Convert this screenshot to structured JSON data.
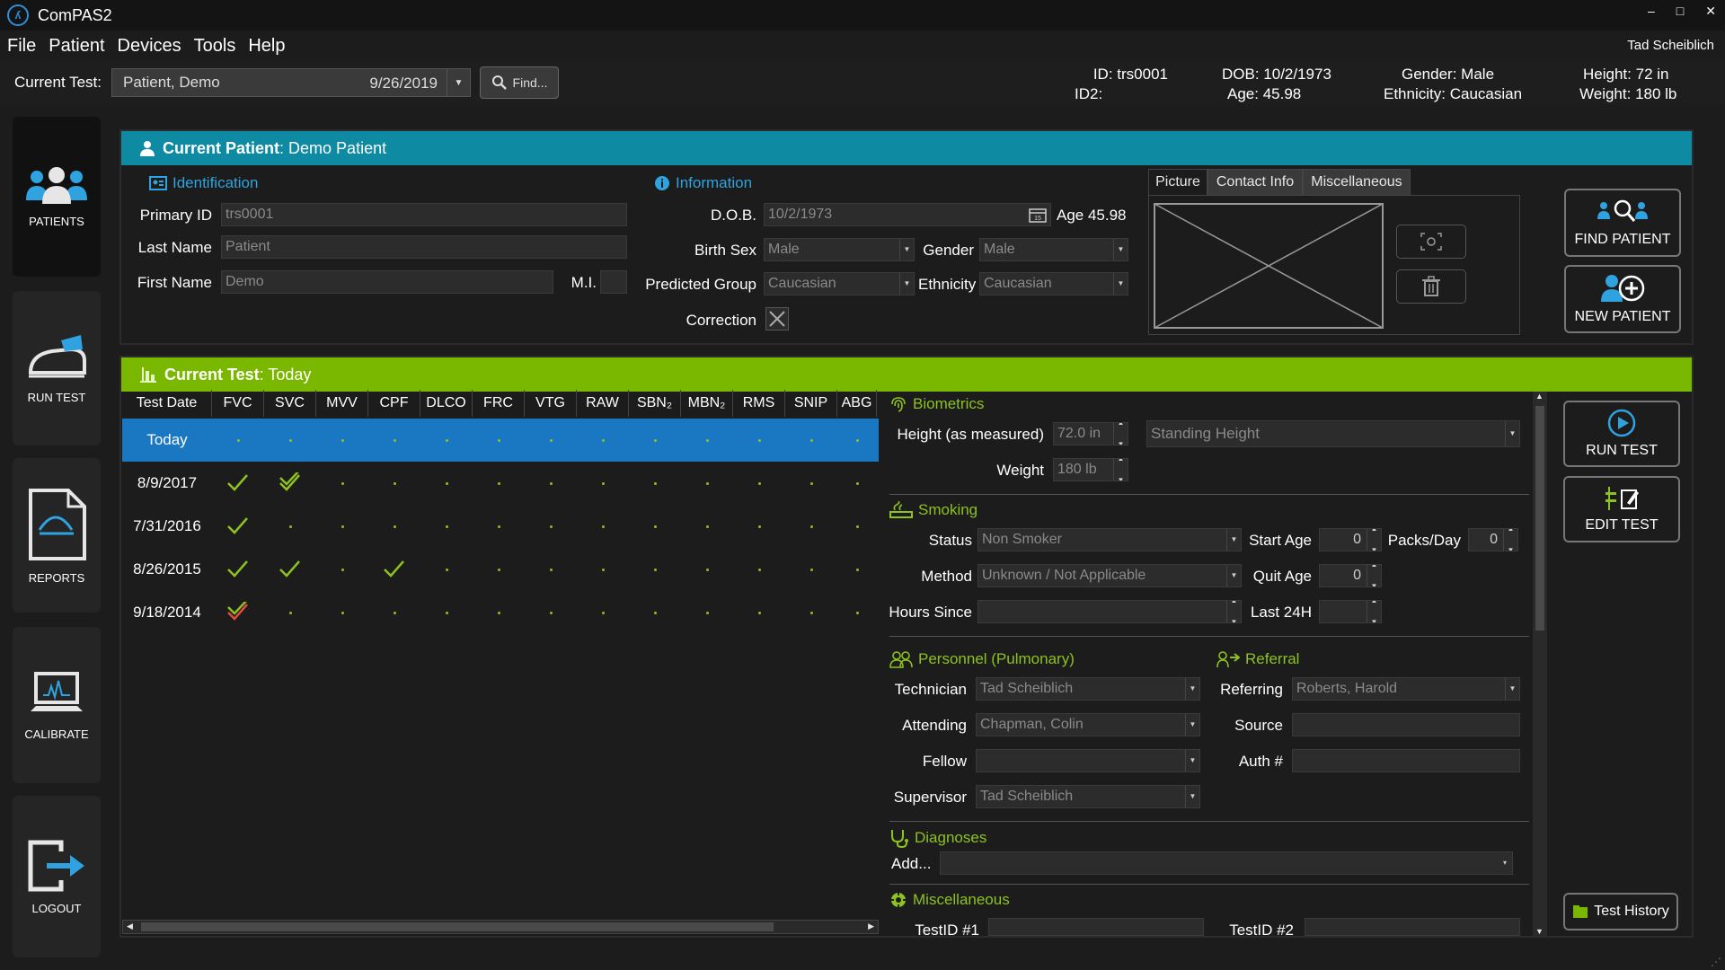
{
  "app": {
    "title": "ComPAS2",
    "logo": "compas-logo-icon",
    "window_controls": [
      "–",
      "□",
      "✕"
    ]
  },
  "menu": [
    "File",
    "Patient",
    "Devices",
    "Tools",
    "Help"
  ],
  "user": "Tad Scheiblich",
  "toolbar": {
    "current_test_label": "Current Test:",
    "current_test_patient": "Patient, Demo",
    "current_test_date": "9/26/2019",
    "find_label": "Find..."
  },
  "patient_summary": {
    "id_label": "ID:",
    "id": "trs0001",
    "id2_label": "ID2:",
    "dob_label": "DOB:",
    "dob": "10/2/1973",
    "age_label": "Age:",
    "age": "45.98",
    "gender_label": "Gender:",
    "gender": "Male",
    "ethnicity_label": "Ethnicity:",
    "ethnicity": "Caucasian",
    "height_label": "Height:",
    "height": "72 in",
    "weight_label": "Weight:",
    "weight": "180 lb"
  },
  "nav": [
    {
      "label": "PATIENTS",
      "icon": "patients-icon"
    },
    {
      "label": "RUN TEST",
      "icon": "run-test-icon"
    },
    {
      "label": "REPORTS",
      "icon": "reports-icon"
    },
    {
      "label": "CALIBRATE",
      "icon": "calibrate-icon"
    },
    {
      "label": "LOGOUT",
      "icon": "logout-icon"
    }
  ],
  "current_patient": {
    "header_bold": "Current Patient",
    "header_rest": " : Demo Patient",
    "identification": {
      "title": "Identification",
      "primary_id_label": "Primary ID",
      "primary_id": "trs0001",
      "last_name_label": "Last Name",
      "last_name": "Patient",
      "first_name_label": "First Name",
      "first_name": "Demo",
      "mi_label": "M.I.",
      "mi": ""
    },
    "information": {
      "title": "Information",
      "dob_label": "D.O.B.",
      "dob": "10/2/1973",
      "age_text": "Age 45.98",
      "birth_sex_label": "Birth Sex",
      "birth_sex": "Male",
      "gender_label": "Gender",
      "gender": "Male",
      "predicted_group_label": "Predicted Group",
      "predicted_group": "Caucasian",
      "ethnicity_label": "Ethnicity",
      "ethnicity": "Caucasian",
      "correction_label": "Correction"
    },
    "tabs": [
      "Picture",
      "Contact Info",
      "Miscellaneous"
    ],
    "find_patient": "FIND PATIENT",
    "new_patient": "NEW PATIENT"
  },
  "current_test": {
    "header_bold": "Current Test",
    "header_rest": " : Today",
    "columns": [
      "Test Date",
      "FVC",
      "SVC",
      "MVV",
      "CPF",
      "DLCO",
      "FRC",
      "VTG",
      "RAW",
      "SBN₂",
      "MBN₂",
      "RMS",
      "SNIP",
      "ABG"
    ],
    "rows": [
      {
        "date": "Today",
        "selected": true,
        "marks": [
          "",
          "",
          "",
          "",
          "",
          "",
          "",
          "",
          "",
          "",
          "",
          "",
          ""
        ]
      },
      {
        "date": "8/9/2017",
        "marks": [
          "check",
          "double-check",
          "",
          "",
          "",
          "",
          "",
          "",
          "",
          "",
          "",
          "",
          ""
        ]
      },
      {
        "date": "7/31/2016",
        "marks": [
          "check",
          "",
          "",
          "",
          "",
          "",
          "",
          "",
          "",
          "",
          "",
          "",
          ""
        ]
      },
      {
        "date": "8/26/2015",
        "marks": [
          "check",
          "check",
          "",
          "check",
          "",
          "",
          "",
          "",
          "",
          "",
          "",
          "",
          ""
        ]
      },
      {
        "date": "9/18/2014",
        "marks": [
          "double-check-red",
          "",
          "",
          "",
          "",
          "",
          "",
          "",
          "",
          "",
          "",
          "",
          ""
        ]
      }
    ],
    "biometrics": {
      "title": "Biometrics",
      "height_label": "Height (as measured)",
      "height": "72.0",
      "height_unit": "in",
      "height_method": "Standing Height",
      "weight_label": "Weight",
      "weight": "180",
      "weight_unit": "lb"
    },
    "smoking": {
      "title": "Smoking",
      "status_label": "Status",
      "status": "Non Smoker",
      "start_age_label": "Start Age",
      "start_age": "0",
      "packs_day_label": "Packs/Day",
      "packs_day": "0",
      "method_label": "Method",
      "method": "Unknown / Not Applicable",
      "quit_age_label": "Quit Age",
      "quit_age": "0",
      "hours_since_label": "Hours Since",
      "hours_since": "",
      "last24h_label": "Last 24H",
      "last24h": ""
    },
    "personnel": {
      "title": "Personnel (Pulmonary)",
      "technician_label": "Technician",
      "technician": "Tad Scheiblich",
      "attending_label": "Attending",
      "attending": "Chapman, Colin",
      "fellow_label": "Fellow",
      "fellow": "",
      "supervisor_label": "Supervisor",
      "supervisor": "Tad Scheiblich"
    },
    "referral": {
      "title": "Referral",
      "referring_label": "Referring",
      "referring": "Roberts, Harold",
      "source_label": "Source",
      "source": "",
      "auth_label": "Auth #",
      "auth": ""
    },
    "diagnoses": {
      "title": "Diagnoses",
      "add_label": "Add..."
    },
    "miscellaneous": {
      "title": "Miscellaneous",
      "testid1_label": "TestID #1",
      "testid2_label": "TestID #2"
    },
    "run_test": "RUN TEST",
    "edit_test": "EDIT TEST",
    "test_history": "Test History"
  },
  "colors": {
    "patient_header": "#0f8aa3",
    "test_header": "#7ab800",
    "selected_row": "#1a77c2",
    "accent_blue": "#2fa3e0",
    "accent_green": "#8dc21f"
  }
}
